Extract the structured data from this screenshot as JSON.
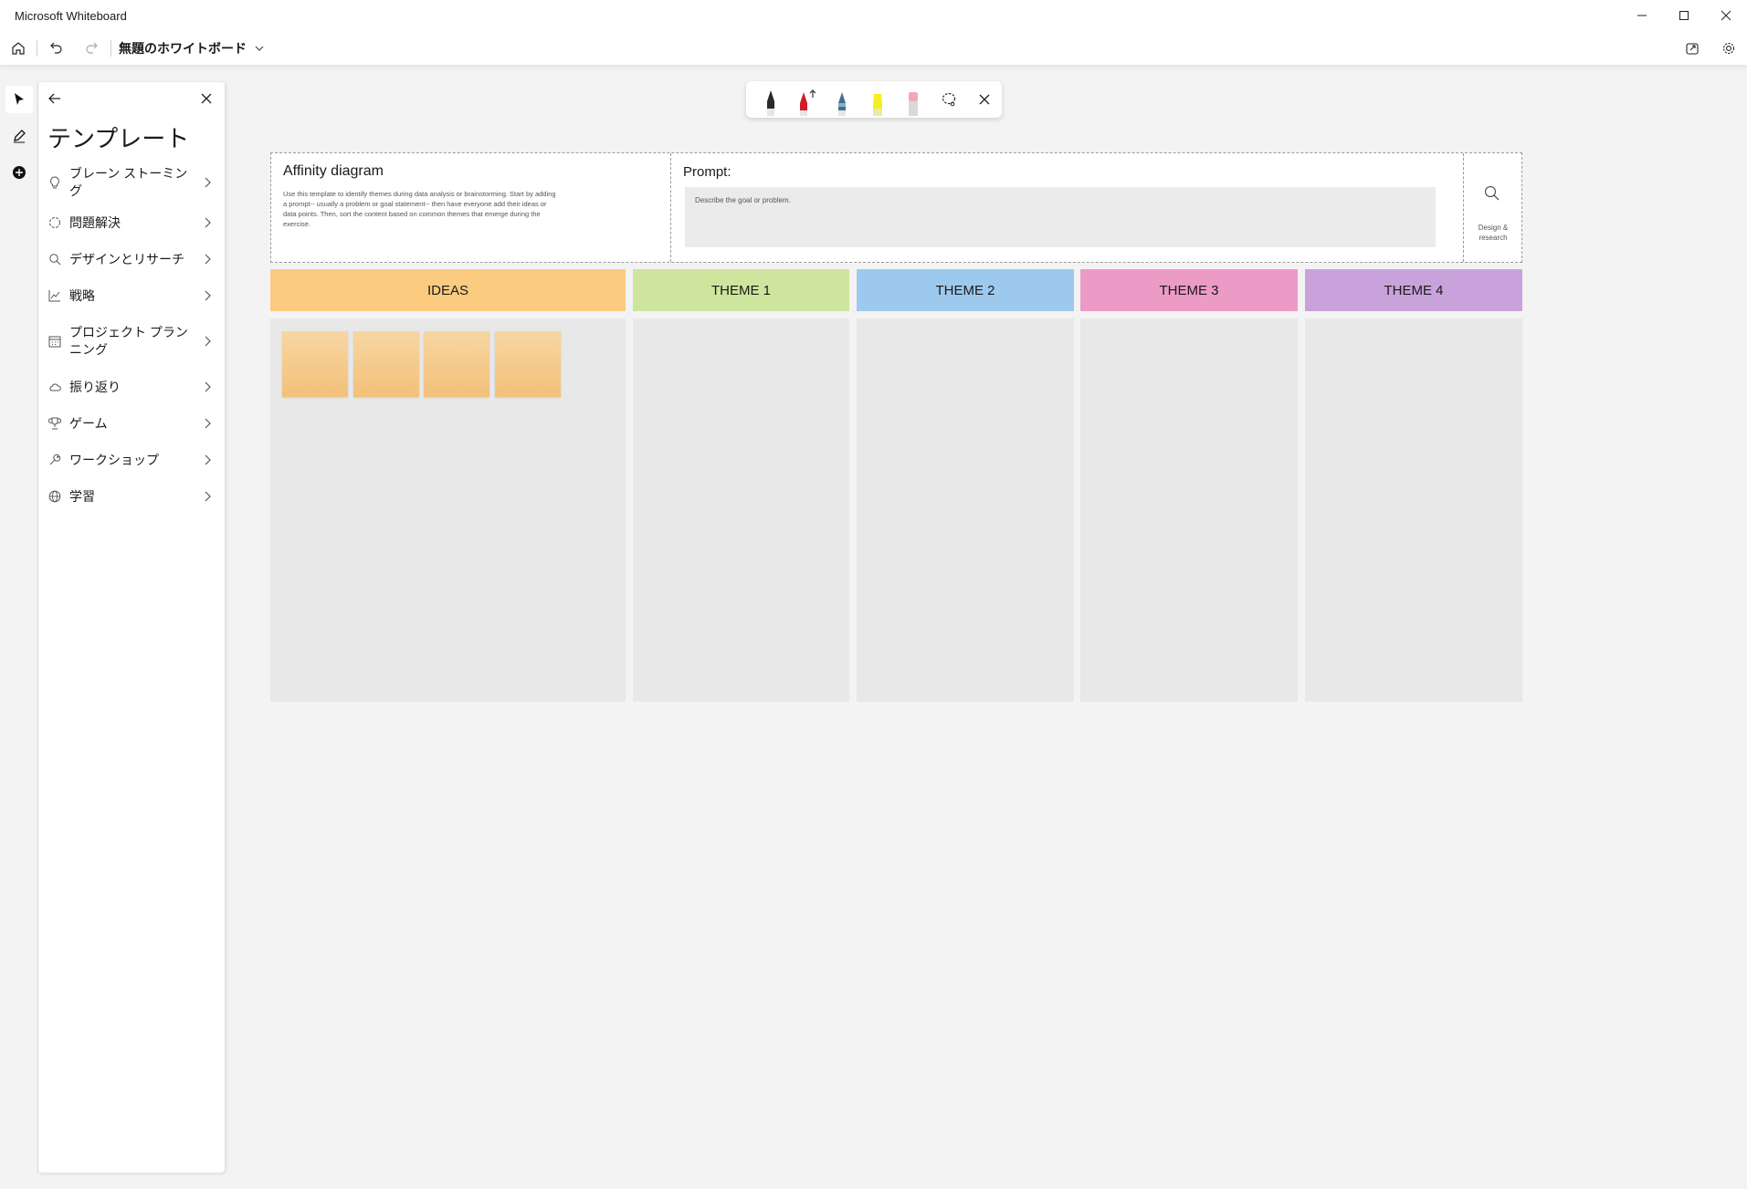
{
  "app": {
    "title": "Microsoft Whiteboard"
  },
  "toolbar": {
    "board_name": "無題のホワイトボード"
  },
  "panel": {
    "title": "テンプレート",
    "items": [
      {
        "label": "ブレーン ストーミング",
        "icon": "lightbulb-icon"
      },
      {
        "label": "問題解決",
        "icon": "puzzle-icon"
      },
      {
        "label": "デザインとリサーチ",
        "icon": "search-icon"
      },
      {
        "label": "戦略",
        "icon": "chart-line-icon"
      },
      {
        "label": "プロジェクト プランニング",
        "icon": "calendar-icon"
      },
      {
        "label": "振り返り",
        "icon": "cloud-sun-icon"
      },
      {
        "label": "ゲーム",
        "icon": "trophy-icon"
      },
      {
        "label": "ワークショップ",
        "icon": "wrench-icon"
      },
      {
        "label": "学習",
        "icon": "globe-icon"
      }
    ]
  },
  "template": {
    "title": "Affinity diagram",
    "description": "Use this template to identify themes during data analysis or brainstorming. Start by adding a prompt-- usually a problem or goal statement-- then have everyone add their ideas or data points. Then, sort the content based on common themes that emerge during the exercise.",
    "prompt_label": "Prompt:",
    "prompt_placeholder": "Describe the goal or problem.",
    "design_label": "Design & research",
    "columns": [
      {
        "label": "IDEAS",
        "color": "#fbcc7f"
      },
      {
        "label": "THEME 1",
        "color": "#cde59c"
      },
      {
        "label": "THEME 2",
        "color": "#9ec9ee"
      },
      {
        "label": "THEME 3",
        "color": "#ec9ac6"
      },
      {
        "label": "THEME 4",
        "color": "#c9a1db"
      }
    ],
    "sticky_note_color": "#f4c98a"
  },
  "pens": [
    "black-pen",
    "red-pen",
    "galaxy-pen",
    "yellow-highlighter",
    "eraser",
    "lasso-select-icon",
    "close-icon"
  ]
}
